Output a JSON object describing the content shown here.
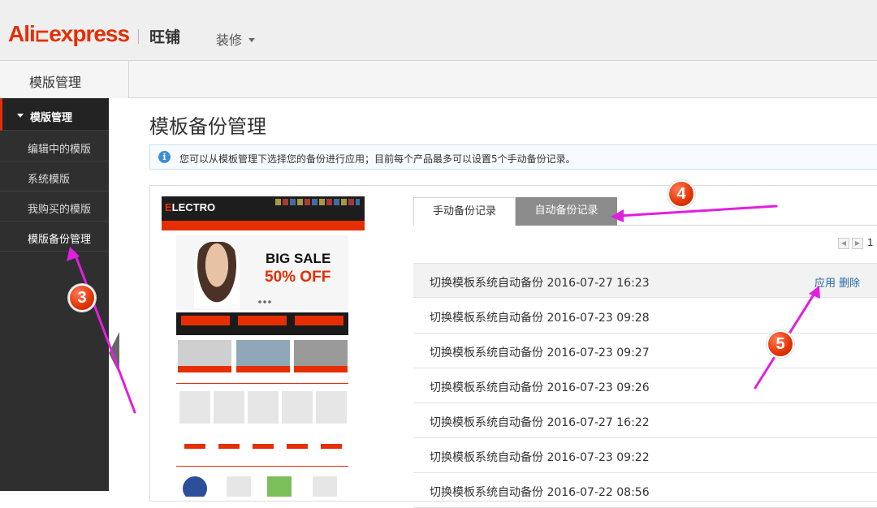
{
  "header": {
    "logo_part1": "Ali",
    "logo_part2": "express",
    "store_name": "旺铺",
    "decor_menu": "装修"
  },
  "subnav": {
    "tab_label": "模版管理"
  },
  "sidebar": {
    "section_title": "模版管理",
    "items": [
      {
        "label": "编辑中的模版"
      },
      {
        "label": "系统模版"
      },
      {
        "label": "我购买的模版"
      },
      {
        "label": "模版备份管理"
      }
    ]
  },
  "main": {
    "title": "模板备份管理",
    "info": "您可以从模板管理下选择您的备份进行应用；目前每个产品最多可以设置5个手动备份记录。",
    "thumbnail": {
      "brand_prefix": "E",
      "brand_rest": "LECTRO",
      "headline1": "BIG SALE",
      "headline2": "50% OFF"
    },
    "tabs": [
      {
        "label": "手动备份记录",
        "active": false
      },
      {
        "label": "自动备份记录",
        "active": true
      }
    ],
    "pager": {
      "current": "1 ‹"
    },
    "rows": [
      {
        "name": "切换模板系统自动备份 2016-07-27 16:23",
        "apply": "应用",
        "delete": "删除"
      },
      {
        "name": "切换模板系统自动备份 2016-07-23 09:28"
      },
      {
        "name": "切换模板系统自动备份 2016-07-23 09:27"
      },
      {
        "name": "切换模板系统自动备份 2016-07-23 09:26"
      },
      {
        "name": "切换模板系统自动备份 2016-07-27 16:22"
      },
      {
        "name": "切换模板系统自动备份 2016-07-23 09:22"
      },
      {
        "name": "切换模板系统自动备份 2016-07-22 08:56"
      }
    ]
  },
  "annotations": {
    "badge3": "3",
    "badge4": "4",
    "badge5": "5",
    "arrow_color": "#e020e0",
    "badge_color": "#e23405"
  },
  "colors": {
    "brand_red": "#e62e04",
    "brand_orange": "#f29d00",
    "sidebar_bg": "#2f2f2f",
    "link_blue": "#2468a8",
    "active_tab": "#8c8c8c"
  }
}
